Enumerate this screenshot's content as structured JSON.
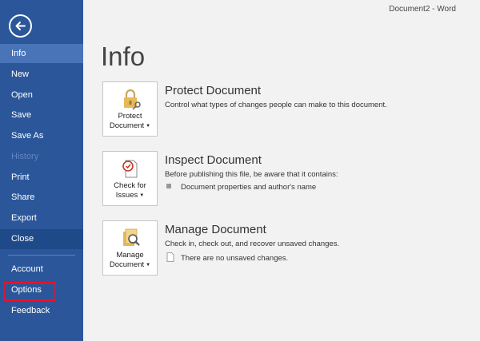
{
  "window": {
    "title": "Document2 - Word"
  },
  "sidebar": {
    "items": [
      {
        "label": "Info"
      },
      {
        "label": "New"
      },
      {
        "label": "Open"
      },
      {
        "label": "Save"
      },
      {
        "label": "Save As"
      },
      {
        "label": "History"
      },
      {
        "label": "Print"
      },
      {
        "label": "Share"
      },
      {
        "label": "Export"
      },
      {
        "label": "Close"
      },
      {
        "label": "Account"
      },
      {
        "label": "Options"
      },
      {
        "label": "Feedback"
      }
    ],
    "accent": "#2b579a",
    "highlight_color": "#e8112d"
  },
  "main": {
    "heading": "Info",
    "sections": [
      {
        "tile_line1": "Protect",
        "tile_line2": "Document",
        "title": "Protect Document",
        "desc": "Control what types of changes people can make to this document."
      },
      {
        "tile_line1": "Check for",
        "tile_line2": "Issues",
        "title": "Inspect Document",
        "desc": "Before publishing this file, be aware that it contains:",
        "sub": "Document properties and author's name"
      },
      {
        "tile_line1": "Manage",
        "tile_line2": "Document",
        "title": "Manage Document",
        "desc": "Check in, check out, and recover unsaved changes.",
        "sub": "There are no unsaved changes."
      }
    ]
  }
}
